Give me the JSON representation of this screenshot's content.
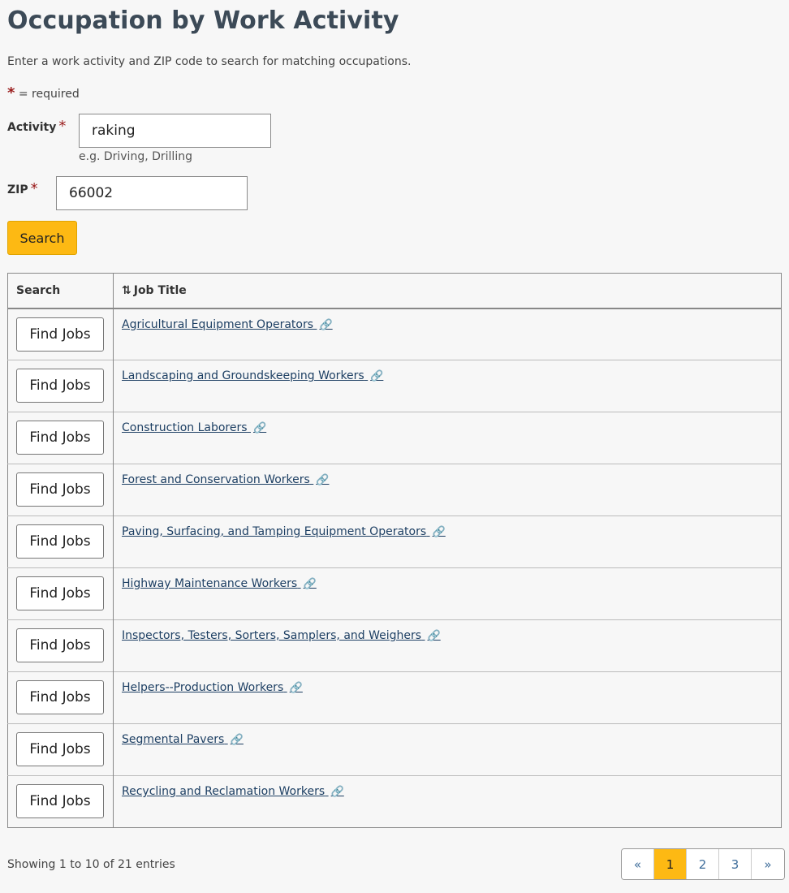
{
  "page": {
    "title": "Occupation by Work Activity",
    "intro": "Enter a work activity and ZIP code to search for matching occupations.",
    "required_symbol": "*",
    "required_text": "= required"
  },
  "form": {
    "activity_label": "Activity",
    "activity_value": "raking",
    "activity_hint": "e.g. Driving, Drilling",
    "zip_label": "ZIP",
    "zip_value": "66002",
    "search_label": "Search"
  },
  "table": {
    "col_search": "Search",
    "col_job_title": "Job Title",
    "find_jobs_label": "Find Jobs",
    "rows": [
      "Agricultural Equipment Operators",
      "Landscaping and Groundskeeping Workers",
      "Construction Laborers",
      "Forest and Conservation Workers",
      "Paving, Surfacing, and Tamping Equipment Operators",
      "Highway Maintenance Workers",
      "Inspectors, Testers, Sorters, Samplers, and Weighers",
      "Helpers--Production Workers",
      "Segmental Pavers",
      "Recycling and Reclamation Workers"
    ]
  },
  "footer": {
    "entries_info": "Showing 1 to 10 of 21 entries",
    "pagination": {
      "prev": "«",
      "pages": [
        "1",
        "2",
        "3"
      ],
      "active_page": "1",
      "next": "»"
    }
  },
  "icons": {
    "sort": "sort-icon",
    "link": "link-icon"
  },
  "colors": {
    "accent": "#fdb913",
    "title": "#3c4a57",
    "link": "#1d3f63",
    "required": "#9a1c1c"
  }
}
